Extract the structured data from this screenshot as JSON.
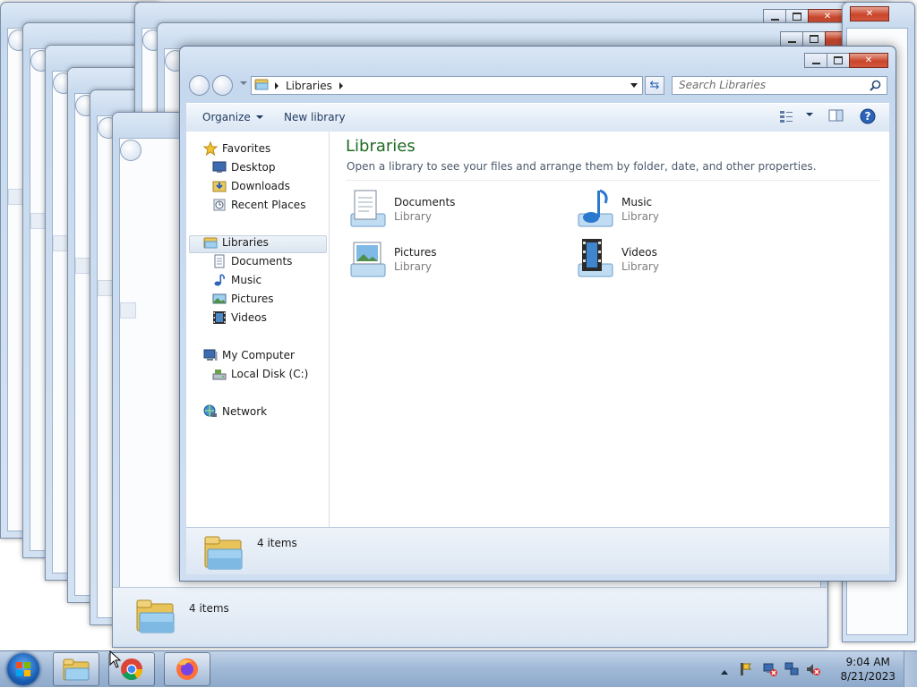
{
  "window": {
    "address_crumb": "Libraries",
    "search_placeholder": "Search Libraries",
    "refresh_icon": "refresh-icon",
    "help_icon": "help-icon"
  },
  "toolbar": {
    "organize_label": "Organize",
    "new_library_label": "New library"
  },
  "nav": {
    "favorites": "Favorites",
    "desktop": "Desktop",
    "downloads": "Downloads",
    "recent_places": "Recent Places",
    "libraries": "Libraries",
    "documents": "Documents",
    "music": "Music",
    "pictures": "Pictures",
    "videos": "Videos",
    "my_computer": "My Computer",
    "local_disk": "Local Disk (C:)",
    "network": "Network"
  },
  "main": {
    "title": "Libraries",
    "subtitle": "Open a library to see your files and arrange them by folder, date, and other properties.",
    "libraries": [
      {
        "name": "Documents",
        "type": "Library",
        "icon": "documents-library-icon"
      },
      {
        "name": "Music",
        "type": "Library",
        "icon": "music-library-icon"
      },
      {
        "name": "Pictures",
        "type": "Library",
        "icon": "pictures-library-icon"
      },
      {
        "name": "Videos",
        "type": "Library",
        "icon": "videos-library-icon"
      }
    ]
  },
  "details": {
    "count": "4 items"
  },
  "background_window": {
    "count": "4 items"
  },
  "taskbar": {
    "apps": [
      "windows-explorer",
      "google-chrome",
      "firefox"
    ],
    "time": "9:04 AM",
    "date": "8/21/2023"
  },
  "colors": {
    "title_green": "#1f6b22",
    "accent_blue": "#2a63b8"
  }
}
